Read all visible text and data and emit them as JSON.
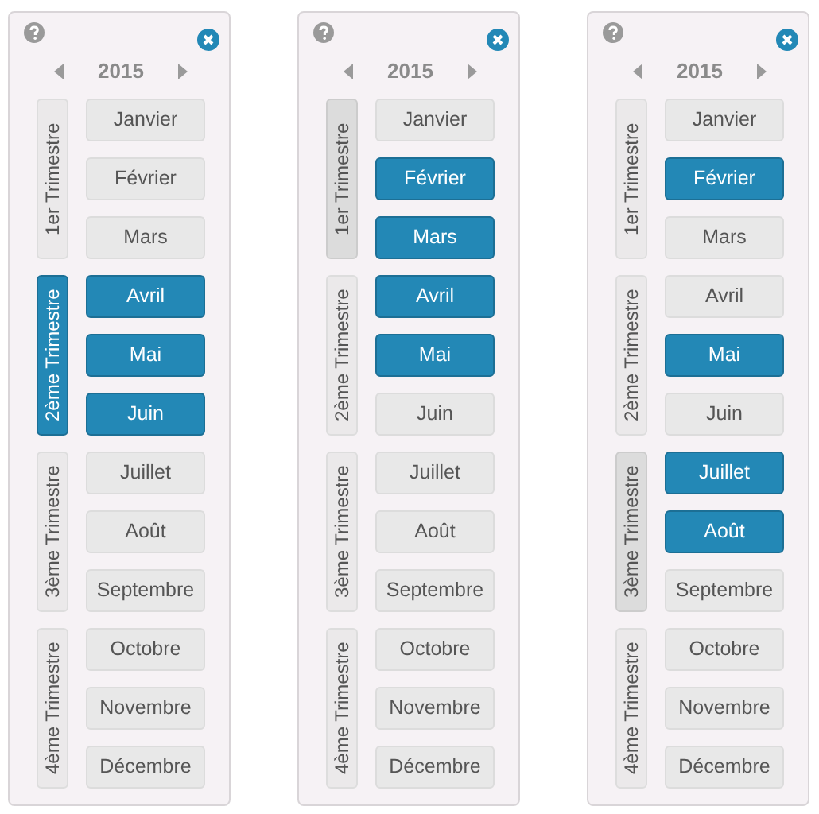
{
  "panels": [
    {
      "year": "2015",
      "quarters": [
        {
          "label": "1er Trimestre",
          "selected": false,
          "highlighted": false,
          "months": [
            {
              "label": "Janvier",
              "selected": false
            },
            {
              "label": "Février",
              "selected": false
            },
            {
              "label": "Mars",
              "selected": false
            }
          ]
        },
        {
          "label": "2ème Trimestre",
          "selected": true,
          "highlighted": false,
          "months": [
            {
              "label": "Avril",
              "selected": true
            },
            {
              "label": "Mai",
              "selected": true
            },
            {
              "label": "Juin",
              "selected": true
            }
          ]
        },
        {
          "label": "3ème Trimestre",
          "selected": false,
          "highlighted": false,
          "months": [
            {
              "label": "Juillet",
              "selected": false
            },
            {
              "label": "Août",
              "selected": false
            },
            {
              "label": "Septembre",
              "selected": false
            }
          ]
        },
        {
          "label": "4ème Trimestre",
          "selected": false,
          "highlighted": false,
          "months": [
            {
              "label": "Octobre",
              "selected": false
            },
            {
              "label": "Novembre",
              "selected": false
            },
            {
              "label": "Décembre",
              "selected": false
            }
          ]
        }
      ]
    },
    {
      "year": "2015",
      "quarters": [
        {
          "label": "1er Trimestre",
          "selected": false,
          "highlighted": true,
          "months": [
            {
              "label": "Janvier",
              "selected": false
            },
            {
              "label": "Février",
              "selected": true
            },
            {
              "label": "Mars",
              "selected": true
            }
          ]
        },
        {
          "label": "2ème Trimestre",
          "selected": false,
          "highlighted": false,
          "months": [
            {
              "label": "Avril",
              "selected": true
            },
            {
              "label": "Mai",
              "selected": true
            },
            {
              "label": "Juin",
              "selected": false
            }
          ]
        },
        {
          "label": "3ème Trimestre",
          "selected": false,
          "highlighted": false,
          "months": [
            {
              "label": "Juillet",
              "selected": false
            },
            {
              "label": "Août",
              "selected": false
            },
            {
              "label": "Septembre",
              "selected": false
            }
          ]
        },
        {
          "label": "4ème Trimestre",
          "selected": false,
          "highlighted": false,
          "months": [
            {
              "label": "Octobre",
              "selected": false
            },
            {
              "label": "Novembre",
              "selected": false
            },
            {
              "label": "Décembre",
              "selected": false
            }
          ]
        }
      ]
    },
    {
      "year": "2015",
      "quarters": [
        {
          "label": "1er Trimestre",
          "selected": false,
          "highlighted": false,
          "months": [
            {
              "label": "Janvier",
              "selected": false
            },
            {
              "label": "Février",
              "selected": true
            },
            {
              "label": "Mars",
              "selected": false
            }
          ]
        },
        {
          "label": "2ème Trimestre",
          "selected": false,
          "highlighted": false,
          "months": [
            {
              "label": "Avril",
              "selected": false
            },
            {
              "label": "Mai",
              "selected": true
            },
            {
              "label": "Juin",
              "selected": false
            }
          ]
        },
        {
          "label": "3ème Trimestre",
          "selected": false,
          "highlighted": true,
          "months": [
            {
              "label": "Juillet",
              "selected": true
            },
            {
              "label": "Août",
              "selected": true
            },
            {
              "label": "Septembre",
              "selected": false
            }
          ]
        },
        {
          "label": "4ème Trimestre",
          "selected": false,
          "highlighted": false,
          "months": [
            {
              "label": "Octobre",
              "selected": false
            },
            {
              "label": "Novembre",
              "selected": false
            },
            {
              "label": "Décembre",
              "selected": false
            }
          ]
        }
      ]
    }
  ]
}
